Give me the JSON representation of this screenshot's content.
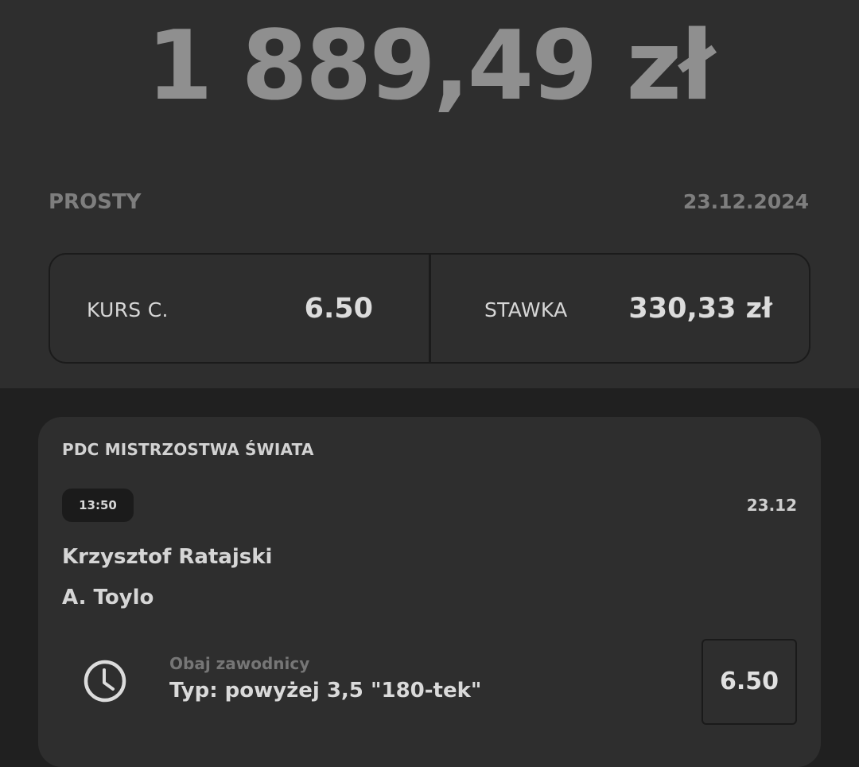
{
  "summary": {
    "payout": "1 889,49 zł",
    "bet_type": "PROSTY",
    "date": "23.12.2024",
    "total_odds_label": "KURS C.",
    "total_odds_value": "6.50",
    "stake_label": "STAWKA",
    "stake_value": "330,33 zł"
  },
  "event": {
    "league": "PDC MISTRZOSTWA ŚWIATA",
    "time": "13:50",
    "date": "23.12",
    "player_home": "Krzysztof Ratajski",
    "player_away": "A. Toylo",
    "status_icon": "clock-icon",
    "market": "Obaj zawodnicy",
    "selection": "Typ: powyżej 3,5 \"180-tek\"",
    "odds": "6.50"
  },
  "colors": {
    "page_bg": "#202020",
    "panel_bg": "#2e2e2e",
    "payout_text": "#8f8f8f",
    "muted_text": "#7e7e7e",
    "primary_text": "#d6d6d6",
    "border": "#1b1b1b"
  }
}
